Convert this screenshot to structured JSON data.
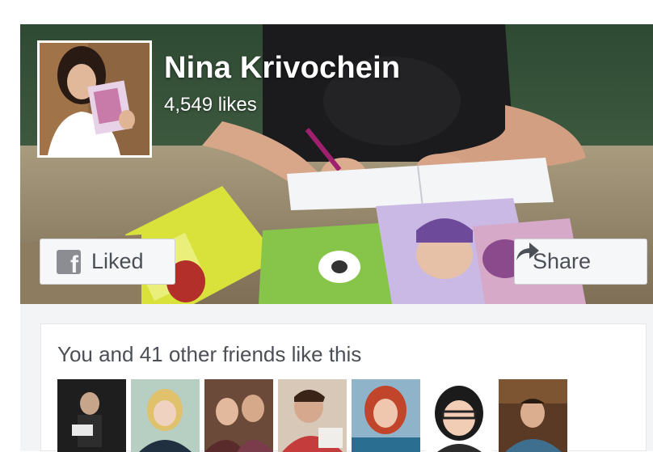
{
  "page": {
    "name": "Nina Krivochein",
    "likes": "4,549 likes"
  },
  "buttons": {
    "liked_label": "Liked",
    "share_label": "Share",
    "fb_glyph": "f"
  },
  "friends": {
    "summary": "You and 41 other friends like this",
    "avatars": [
      {
        "name": "friend-avatar-1"
      },
      {
        "name": "friend-avatar-2"
      },
      {
        "name": "friend-avatar-3"
      },
      {
        "name": "friend-avatar-4"
      },
      {
        "name": "friend-avatar-5"
      },
      {
        "name": "friend-avatar-6"
      },
      {
        "name": "friend-avatar-7"
      }
    ]
  },
  "colors": {
    "button_bg": "#f6f7f9",
    "button_text": "#4b4f56",
    "panel_bg": "#ffffff"
  }
}
